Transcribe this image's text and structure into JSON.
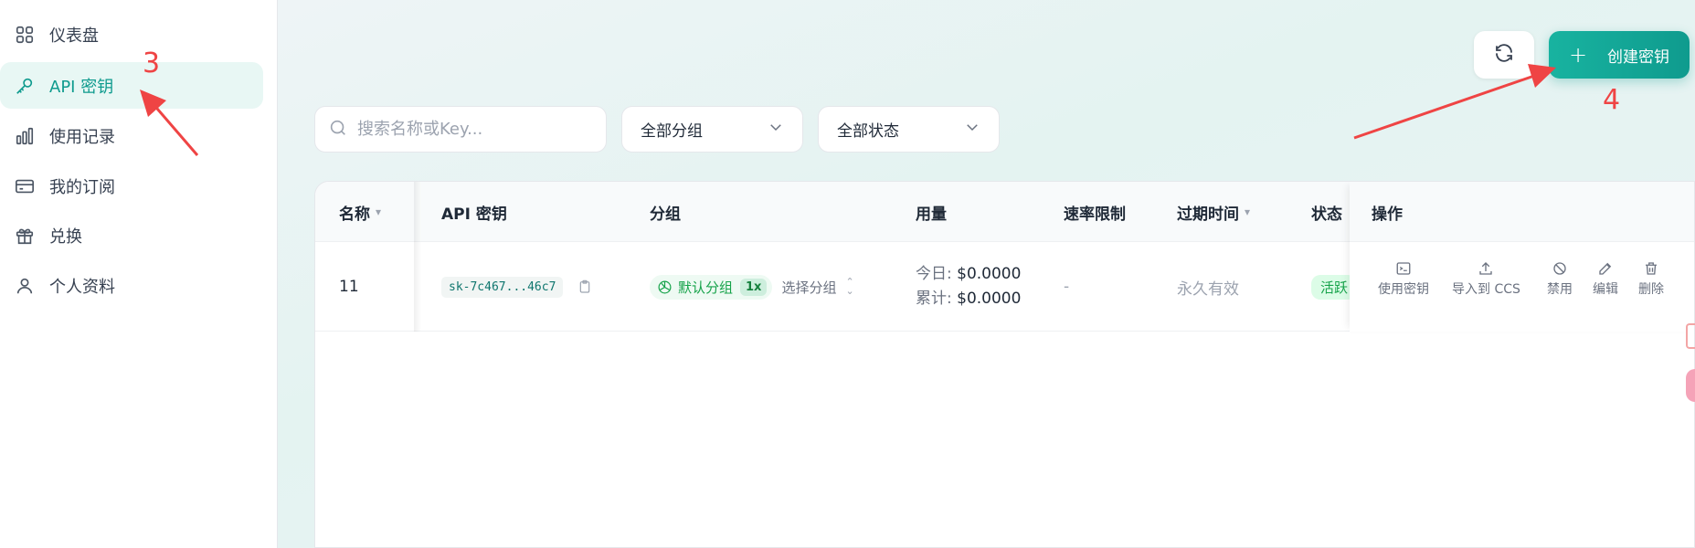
{
  "sidebar": {
    "items": [
      {
        "label": "仪表盘",
        "icon": "grid-icon",
        "active": false
      },
      {
        "label": "API 密钥",
        "icon": "key-icon",
        "active": true
      },
      {
        "label": "使用记录",
        "icon": "bar-chart-icon",
        "active": false
      },
      {
        "label": "我的订阅",
        "icon": "credit-card-icon",
        "active": false
      },
      {
        "label": "兑换",
        "icon": "gift-icon",
        "active": false
      },
      {
        "label": "个人资料",
        "icon": "user-icon",
        "active": false
      }
    ]
  },
  "toolbar": {
    "refresh_icon": "refresh-icon",
    "create_label": "创建密钥"
  },
  "filters": {
    "search_placeholder": "搜索名称或Key...",
    "group_select": "全部分组",
    "status_select": "全部状态"
  },
  "annotations": {
    "step3": "3",
    "step4": "4",
    "color": "#ef4444"
  },
  "table": {
    "headers": {
      "name": "名称",
      "key": "API 密钥",
      "group": "分组",
      "usage": "用量",
      "rate_limit": "速率限制",
      "expires": "过期时间",
      "status": "状态",
      "actions": "操作"
    },
    "rows": [
      {
        "name": "11",
        "key": "sk-7c467...46c7",
        "group": "默认分组",
        "multiplier": "1x",
        "select_group": "选择分组",
        "usage_today_label": "今日:",
        "usage_today": "$0.0000",
        "usage_total_label": "累计:",
        "usage_total": "$0.0000",
        "rate_limit": "-",
        "expires": "永久有效",
        "status": "活跃"
      }
    ],
    "actions": {
      "use_key": "使用密钥",
      "import_ccs": "导入到 CCS",
      "disable": "禁用",
      "edit": "编辑",
      "delete": "删除"
    }
  },
  "colors": {
    "accent": "#0f9b8e",
    "active_bg": "#e8f7f4",
    "status_green": "#16a34a"
  }
}
